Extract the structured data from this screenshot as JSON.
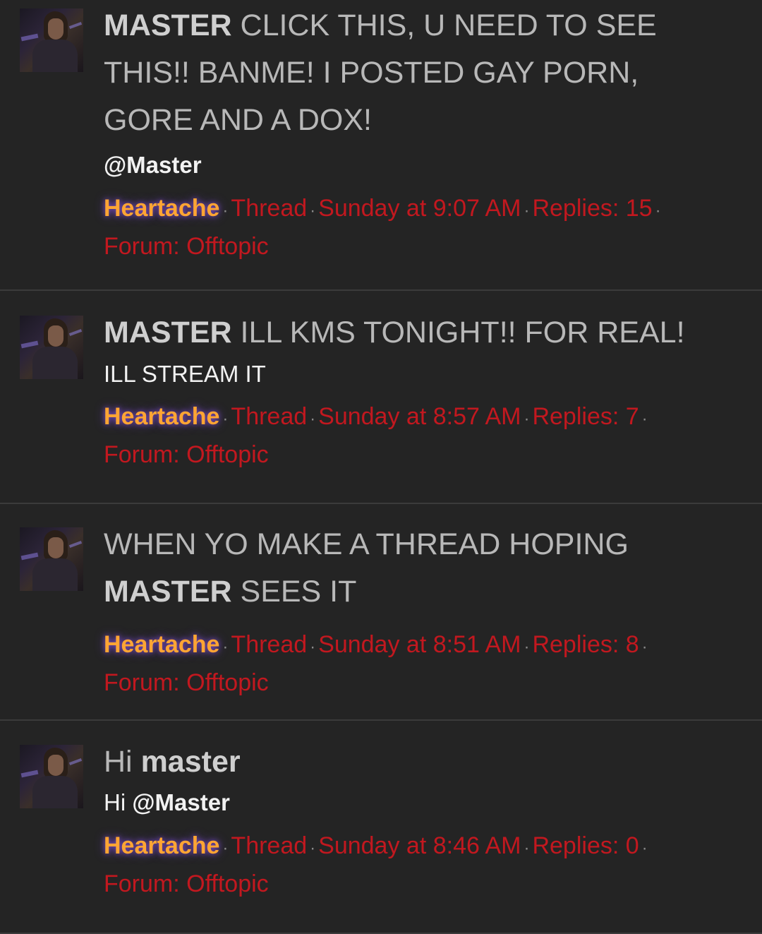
{
  "results": [
    {
      "title_highlight": "MASTER",
      "title_rest": " CLICK THIS, U NEED TO SEE THIS!! BANME! I POSTED GAY PORN, GORE AND A DOX!",
      "snippet_prefix": "",
      "snippet_mention": "@Master",
      "snippet_suffix": "",
      "author": "Heartache",
      "content_type": "Thread",
      "date": "Sunday at 9:07 AM",
      "replies": "Replies: 15",
      "forum": "Forum: Offtopic"
    },
    {
      "title_highlight": "MASTER",
      "title_rest": " ILL KMS TONIGHT!! FOR REAL!",
      "snippet_prefix": "ILL STREAM IT",
      "snippet_mention": "",
      "snippet_suffix": "",
      "author": "Heartache",
      "content_type": "Thread",
      "date": "Sunday at 8:57 AM",
      "replies": "Replies: 7",
      "forum": "Forum: Offtopic"
    },
    {
      "title_prefix": "WHEN YO MAKE A THREAD HOPING ",
      "title_highlight": "MASTER",
      "title_rest": " SEES IT",
      "author": "Heartache",
      "content_type": "Thread",
      "date": "Sunday at 8:51 AM",
      "replies": "Replies: 8",
      "forum": "Forum: Offtopic"
    },
    {
      "title_prefix": "Hi ",
      "title_highlight": "master",
      "title_rest": "",
      "snippet_prefix": "Hi ",
      "snippet_mention": "@Master",
      "snippet_suffix": "",
      "author": "Heartache",
      "content_type": "Thread",
      "date": "Sunday at 8:46 AM",
      "replies": "Replies: 0",
      "forum": "Forum: Offtopic"
    }
  ],
  "colors": {
    "background": "#242424",
    "title": "#b8b8b8",
    "author": "#ffa533",
    "meta_link": "#c2181f",
    "divider": "#3b3b3b"
  },
  "icons": {
    "avatar": "user-avatar-image"
  }
}
